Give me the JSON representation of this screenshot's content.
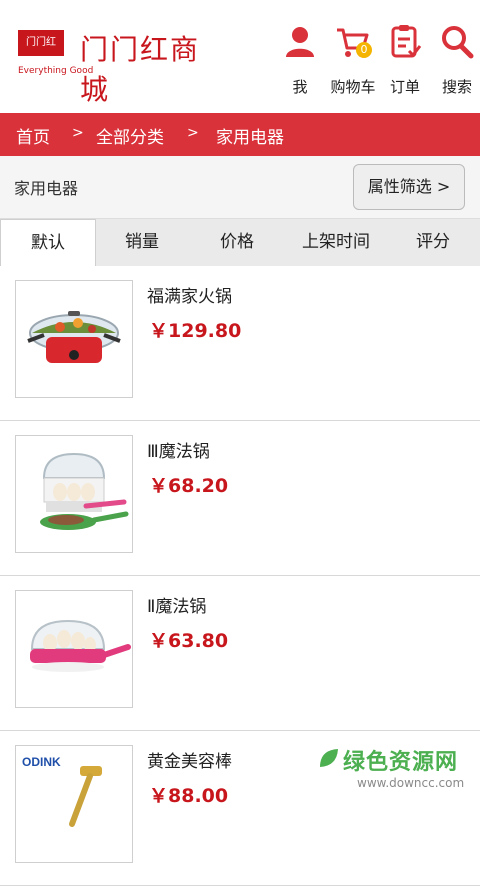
{
  "header": {
    "logo_box_text": "门门红",
    "logo_name": "门门红商城",
    "logo_sub": "Everything Good",
    "nav": [
      {
        "label": "我",
        "icon": "user-icon"
      },
      {
        "label": "购物车",
        "icon": "cart-icon",
        "badge": "0"
      },
      {
        "label": "订单",
        "icon": "order-icon"
      },
      {
        "label": "搜索",
        "icon": "search-icon"
      }
    ]
  },
  "breadcrumb": {
    "items": [
      "首页",
      "全部分类",
      "家用电器"
    ],
    "separator": ">"
  },
  "category": {
    "title": "家用电器",
    "filter_label": "属性筛选 >"
  },
  "sort_tabs": [
    {
      "label": "默认",
      "active": true
    },
    {
      "label": "销量",
      "active": false
    },
    {
      "label": "价格",
      "active": false
    },
    {
      "label": "上架时间",
      "active": false
    },
    {
      "label": "评分",
      "active": false
    }
  ],
  "products": [
    {
      "name": "福满家火锅",
      "price": "￥129.80",
      "image": "hotpot-image"
    },
    {
      "name": "Ⅲ魔法锅",
      "price": "￥68.20",
      "image": "egg-cooker-image"
    },
    {
      "name": "Ⅱ魔法锅",
      "price": "￥63.80",
      "image": "egg-pan-image"
    },
    {
      "name": "黄金美容棒",
      "price": "￥88.00",
      "image": "beauty-bar-image",
      "image_brand": "ODINK"
    }
  ],
  "watermark": {
    "main": "绿色资源网",
    "sub": "www.downcc.com"
  },
  "colors": {
    "brand_red": "#c8161d",
    "breadcrumb_bg": "#d9323a",
    "badge": "#f4b400",
    "watermark_green": "#4caf50"
  }
}
